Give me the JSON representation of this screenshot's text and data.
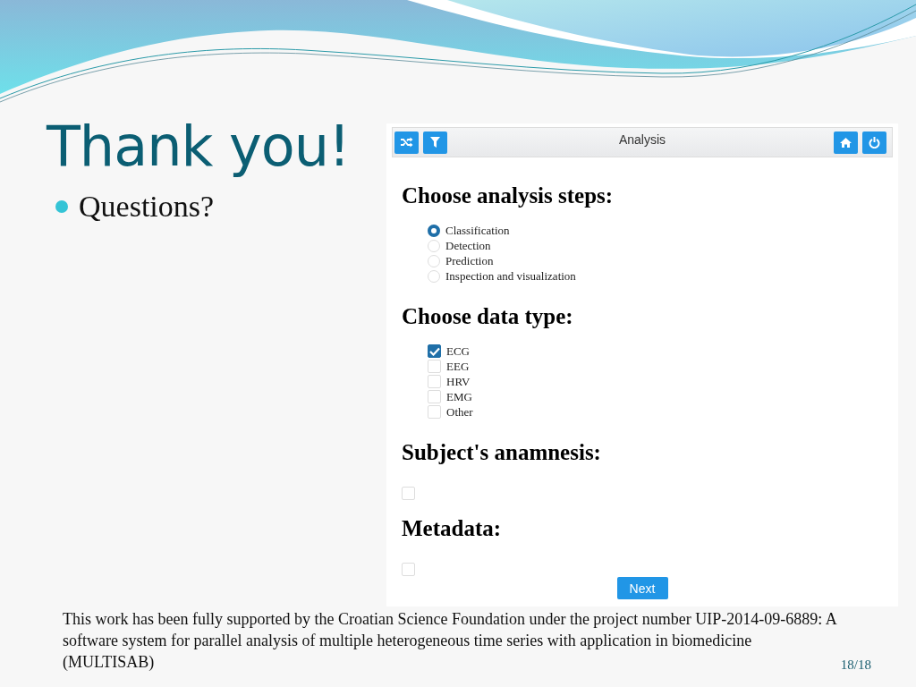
{
  "slide": {
    "title": "Thank you!",
    "bullets": [
      "Questions?"
    ],
    "footer": "This work has been fully supported by the Croatian Science Foundation under the project number UIP-2014-09-6889:  A software system for parallel analysis of multiple heterogeneous time series with application in biomedicine (MULTISAB)",
    "page_number": "18/18"
  },
  "app": {
    "window": {
      "title": "Analysis"
    },
    "sections": [
      {
        "heading": "Choose analysis steps:",
        "kind": "radio",
        "options": [
          {
            "label": "Classification",
            "selected": true
          },
          {
            "label": "Detection",
            "selected": false
          },
          {
            "label": "Prediction",
            "selected": false
          },
          {
            "label": "Inspection and visualization",
            "selected": false
          }
        ]
      },
      {
        "heading": "Choose data type:",
        "kind": "checkbox",
        "options": [
          {
            "label": "ECG",
            "checked": true
          },
          {
            "label": "EEG",
            "checked": false
          },
          {
            "label": "HRV",
            "checked": false
          },
          {
            "label": "EMG",
            "checked": false
          },
          {
            "label": "Other",
            "checked": false
          }
        ]
      },
      {
        "heading": "Subject's anamnesis:",
        "kind": "toggle",
        "options": [
          {
            "checked": false
          }
        ]
      },
      {
        "heading": "Metadata:",
        "kind": "toggle",
        "options": [
          {
            "checked": false
          }
        ]
      }
    ],
    "next_button": "Next"
  }
}
